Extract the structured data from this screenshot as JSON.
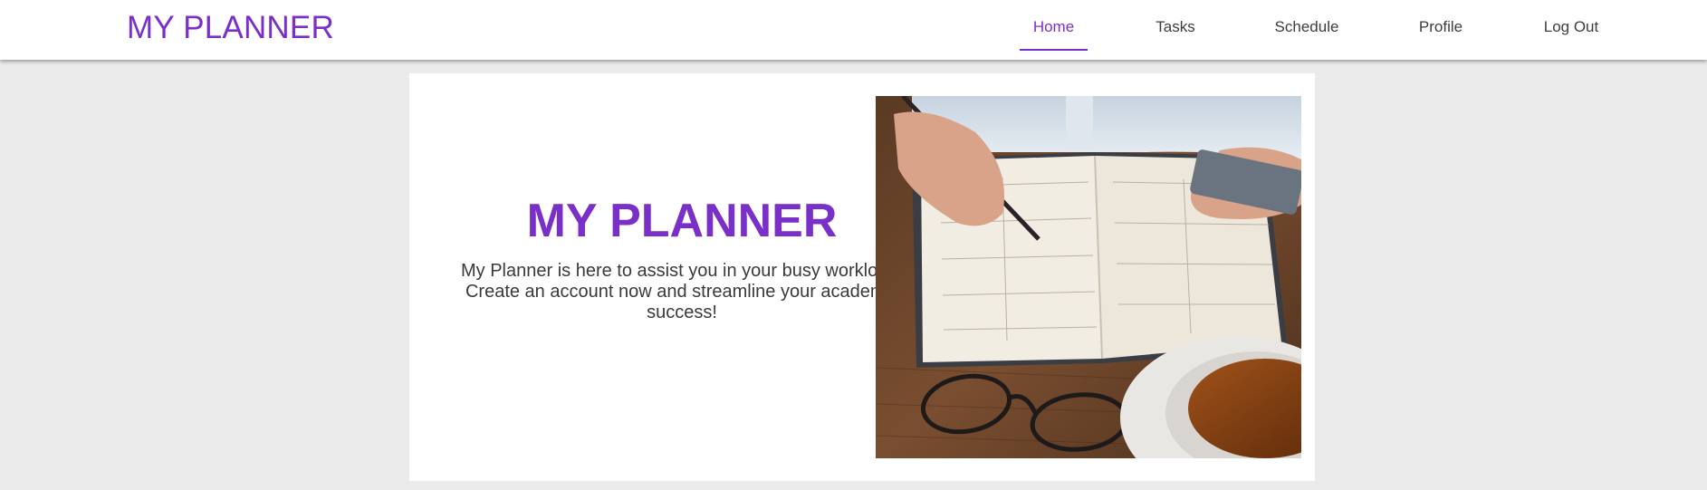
{
  "navbar": {
    "brand": "MY PLANNER",
    "items": [
      {
        "label": "Home",
        "active": true
      },
      {
        "label": "Tasks",
        "active": false
      },
      {
        "label": "Schedule",
        "active": false
      },
      {
        "label": "Profile",
        "active": false
      },
      {
        "label": "Log Out",
        "active": false
      }
    ]
  },
  "hero": {
    "title": "MY PLANNER",
    "description": "My Planner is here to assist you in your busy workload. Create an account now and streamline your academic success!",
    "image": "planner-notebook-photo"
  },
  "colors": {
    "accent": "#7b2fc9",
    "background": "#ebebec",
    "text": "#3a3a3a"
  }
}
